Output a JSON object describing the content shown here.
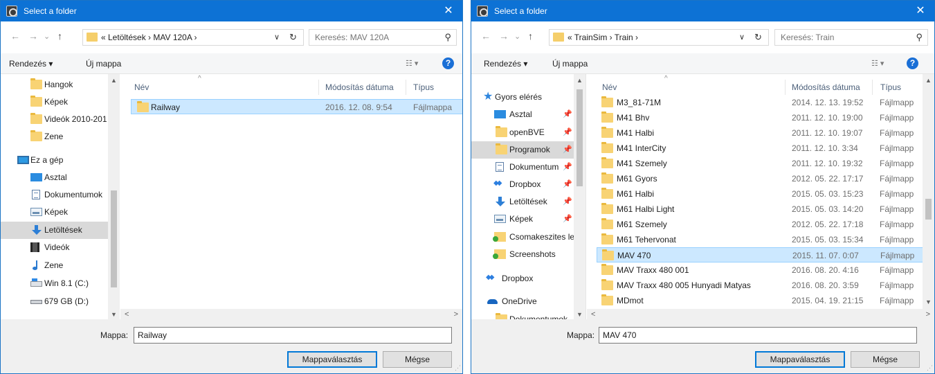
{
  "dialog1": {
    "title": "Select a folder",
    "close_glyph": "✕",
    "nav": {
      "back": "←",
      "forward": "→",
      "recent": "⌄",
      "up": "↑"
    },
    "address": {
      "crumbs": "« Letöltések  ›  MAV 120A  ›",
      "dropdown": "∨",
      "refresh": "↻"
    },
    "search": {
      "placeholder": "Keresés: MAV 120A",
      "icon": "⚲"
    },
    "toolbar": {
      "organize": "Rendezés ▾",
      "new_folder": "Új mappa",
      "view": "☷ ▾",
      "help": "?"
    },
    "sidebar": [
      {
        "label": "Hangok",
        "icon": "folder"
      },
      {
        "label": "Képek",
        "icon": "folder"
      },
      {
        "label": "Videók 2010-201",
        "icon": "folder"
      },
      {
        "label": "Zene",
        "icon": "folder"
      },
      {
        "label": "Ez a gép",
        "icon": "monitor"
      },
      {
        "label": "Asztal",
        "icon": "desktop"
      },
      {
        "label": "Dokumentumok",
        "icon": "doc"
      },
      {
        "label": "Képek",
        "icon": "pictures"
      },
      {
        "label": "Letöltések",
        "icon": "download",
        "selected": true
      },
      {
        "label": "Videók",
        "icon": "video"
      },
      {
        "label": "Zene",
        "icon": "music"
      },
      {
        "label": "Win 8.1 (C:)",
        "icon": "drive"
      },
      {
        "label": "679 GB (D:)",
        "icon": "hdd"
      }
    ],
    "columns": {
      "name": "Név",
      "date": "Módosítás dátuma",
      "type": "Típus"
    },
    "files": [
      {
        "name": "Railway",
        "date": "2016. 12. 08. 9:54",
        "type": "Fájlmappa",
        "selected": true
      }
    ],
    "folder_label": "Mappa:",
    "folder_value": "Railway",
    "ok": "Mappaválasztás",
    "cancel": "Mégse"
  },
  "dialog2": {
    "title": "Select a folder",
    "close_glyph": "✕",
    "nav": {
      "back": "←",
      "forward": "→",
      "recent": "⌄",
      "up": "↑"
    },
    "address": {
      "crumbs": "« TrainSim  ›  Train  ›",
      "dropdown": "∨",
      "refresh": "↻"
    },
    "search": {
      "placeholder": "Keresés: Train",
      "icon": "⚲"
    },
    "toolbar": {
      "organize": "Rendezés ▾",
      "new_folder": "Új mappa",
      "view": "☷ ▾",
      "help": "?"
    },
    "sidebar": [
      {
        "label": "Gyors elérés",
        "icon": "star"
      },
      {
        "label": "Asztal",
        "icon": "desktop",
        "pinned": true
      },
      {
        "label": "openBVE",
        "icon": "folder",
        "pinned": true
      },
      {
        "label": "Programok",
        "icon": "folder",
        "pinned": true,
        "selected": true
      },
      {
        "label": "Dokumentum",
        "icon": "doc",
        "pinned": true
      },
      {
        "label": "Dropbox",
        "icon": "dropbox",
        "pinned": true
      },
      {
        "label": "Letöltések",
        "icon": "download",
        "pinned": true
      },
      {
        "label": "Képek",
        "icon": "pictures",
        "pinned": true
      },
      {
        "label": "Csomakeszites le",
        "icon": "greenfolder"
      },
      {
        "label": "Screenshots",
        "icon": "greenfolder"
      },
      {
        "label": "Dropbox",
        "icon": "dropbox"
      },
      {
        "label": "OneDrive",
        "icon": "onedrive"
      },
      {
        "label": "Dokumentumok",
        "icon": "folder"
      }
    ],
    "pin_glyph": "📌",
    "columns": {
      "name": "Név",
      "date": "Módosítás dátuma",
      "type": "Típus"
    },
    "files": [
      {
        "name": "M3_81-71M",
        "date": "2014. 12. 13. 19:52",
        "type": "Fájlmapp"
      },
      {
        "name": "M41 Bhv",
        "date": "2011. 12. 10. 19:00",
        "type": "Fájlmapp"
      },
      {
        "name": "M41 Halbi",
        "date": "2011. 12. 10. 19:07",
        "type": "Fájlmapp"
      },
      {
        "name": "M41 InterCity",
        "date": "2011. 12. 10. 3:34",
        "type": "Fájlmapp"
      },
      {
        "name": "M41 Szemely",
        "date": "2011. 12. 10. 19:32",
        "type": "Fájlmapp"
      },
      {
        "name": "M61 Gyors",
        "date": "2012. 05. 22. 17:17",
        "type": "Fájlmapp"
      },
      {
        "name": "M61 Halbi",
        "date": "2015. 05. 03. 15:23",
        "type": "Fájlmapp"
      },
      {
        "name": "M61 Halbi Light",
        "date": "2015. 05. 03. 14:20",
        "type": "Fájlmapp"
      },
      {
        "name": "M61 Szemely",
        "date": "2012. 05. 22. 17:18",
        "type": "Fájlmapp"
      },
      {
        "name": "M61 Tehervonat",
        "date": "2015. 05. 03. 15:34",
        "type": "Fájlmapp"
      },
      {
        "name": "MAV 470",
        "date": "2015. 11. 07. 0:07",
        "type": "Fájlmapp",
        "selected": true
      },
      {
        "name": "MAV Traxx 480 001",
        "date": "2016. 08. 20. 4:16",
        "type": "Fájlmapp"
      },
      {
        "name": "MAV Traxx 480 005 Hunyadi Matyas",
        "date": "2016. 08. 20. 3:59",
        "type": "Fájlmapp"
      },
      {
        "name": "MDmot",
        "date": "2015. 04. 19. 21:15",
        "type": "Fájlmapp"
      }
    ],
    "folder_label": "Mappa:",
    "folder_value": "MAV 470",
    "ok": "Mappaválasztás",
    "cancel": "Mégse"
  }
}
